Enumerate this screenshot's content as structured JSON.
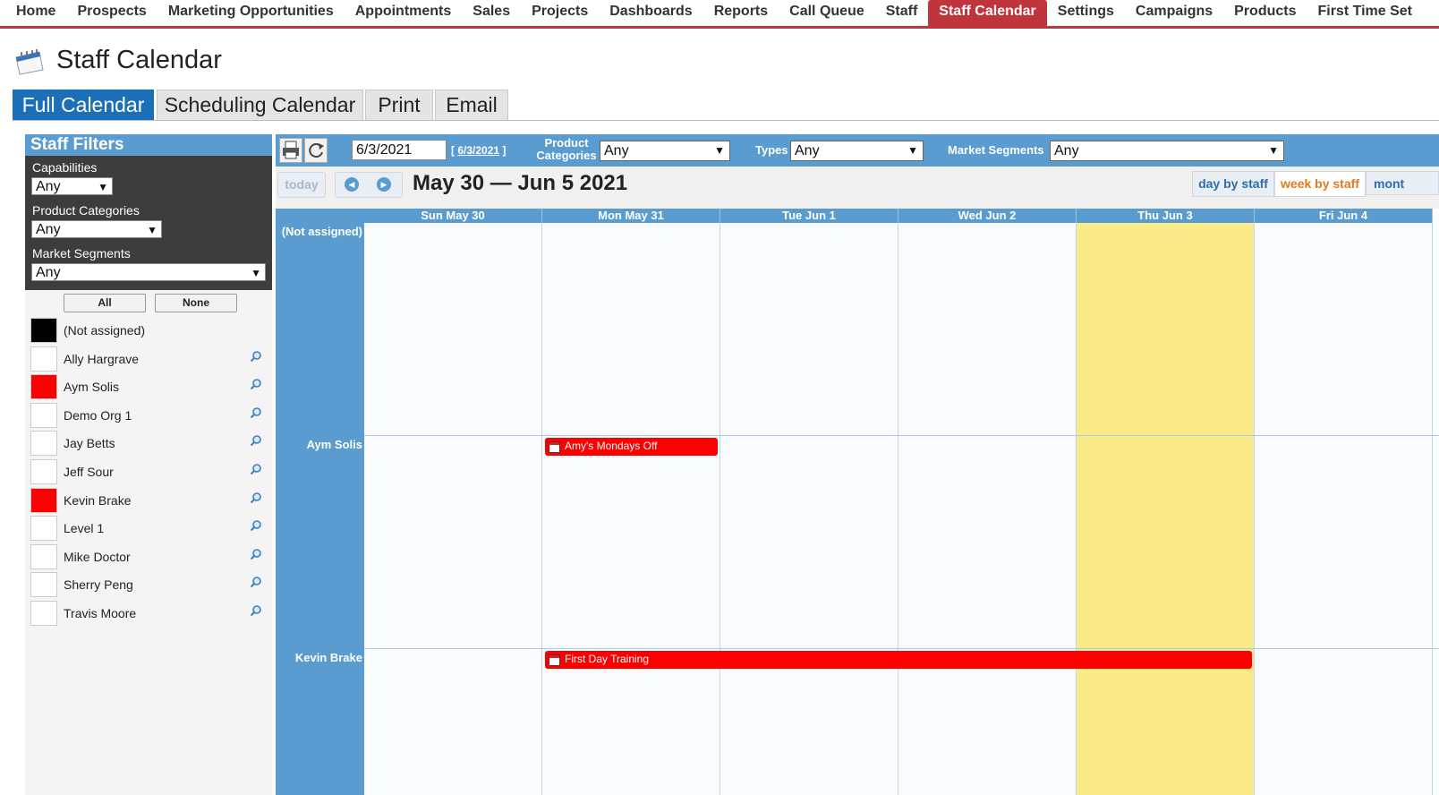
{
  "nav": {
    "items": [
      {
        "label": "Home"
      },
      {
        "label": "Prospects"
      },
      {
        "label": "Marketing Opportunities"
      },
      {
        "label": "Appointments"
      },
      {
        "label": "Sales"
      },
      {
        "label": "Projects"
      },
      {
        "label": "Dashboards"
      },
      {
        "label": "Reports"
      },
      {
        "label": "Call Queue"
      },
      {
        "label": "Staff"
      },
      {
        "label": "Staff Calendar",
        "active": true
      },
      {
        "label": "Settings"
      },
      {
        "label": "Campaigns"
      },
      {
        "label": "Products"
      },
      {
        "label": "First Time Set"
      }
    ],
    "active_color": "#c0343b"
  },
  "page": {
    "title": "Staff Calendar",
    "icon": "calendar-notepad-icon"
  },
  "tabs": [
    {
      "label": "Full Calendar",
      "active": true
    },
    {
      "label": "Scheduling Calendar"
    },
    {
      "label": "Print"
    },
    {
      "label": "Email"
    }
  ],
  "filters": {
    "title": "Staff Filters",
    "capabilities": {
      "label": "Capabilities",
      "value": "Any"
    },
    "product_categories": {
      "label": "Product Categories",
      "value": "Any"
    },
    "market_segments": {
      "label": "Market Segments",
      "value": "Any"
    },
    "all_label": "All",
    "none_label": "None",
    "staff": [
      {
        "name": "(Not assigned)",
        "color": "#000000",
        "zoom": false
      },
      {
        "name": "Ally Hargrave",
        "color": "#ffffff",
        "zoom": true
      },
      {
        "name": "Aym Solis",
        "color": "#ff0000",
        "zoom": true
      },
      {
        "name": "Demo Org 1",
        "color": "#ffffff",
        "zoom": true
      },
      {
        "name": "Jay Betts",
        "color": "#ffffff",
        "zoom": true
      },
      {
        "name": "Jeff Sour",
        "color": "#ffffff",
        "zoom": true
      },
      {
        "name": "Kevin Brake",
        "color": "#ff0000",
        "zoom": true
      },
      {
        "name": "Level 1",
        "color": "#ffffff",
        "zoom": true
      },
      {
        "name": "Mike Doctor",
        "color": "#ffffff",
        "zoom": true
      },
      {
        "name": "Sherry Peng",
        "color": "#ffffff",
        "zoom": true
      },
      {
        "name": "Travis Moore",
        "color": "#ffffff",
        "zoom": true
      }
    ]
  },
  "toolbar": {
    "date_value": "6/3/2021",
    "date_link": "6/3/2021",
    "product_categories_label": "Product Categories",
    "product_categories_value": "Any",
    "types_label": "Types",
    "types_value": "Any",
    "market_segments_label": "Market Segments",
    "market_segments_value": "Any"
  },
  "calendar": {
    "today_label": "today",
    "range_title": "May 30 — Jun 5 2021",
    "views": [
      {
        "label": "day by staff"
      },
      {
        "label": "week by staff",
        "active": true
      },
      {
        "label": "mont"
      }
    ],
    "days": [
      "Sun May 30",
      "Mon May 31",
      "Tue Jun 1",
      "Wed Jun 2",
      "Thu Jun 3",
      "Fri Jun 4"
    ],
    "today_index": 4,
    "rows": [
      "(Not assigned)",
      "Aym Solis",
      "Kevin Brake"
    ],
    "events": [
      {
        "title": "Amy's Mondays Off",
        "row": 1,
        "start_day": 1,
        "span_days": 1,
        "color": "#fc0000"
      },
      {
        "title": "First Day Training",
        "row": 2,
        "start_day": 1,
        "span_days": 4,
        "color": "#fc0000"
      }
    ]
  }
}
